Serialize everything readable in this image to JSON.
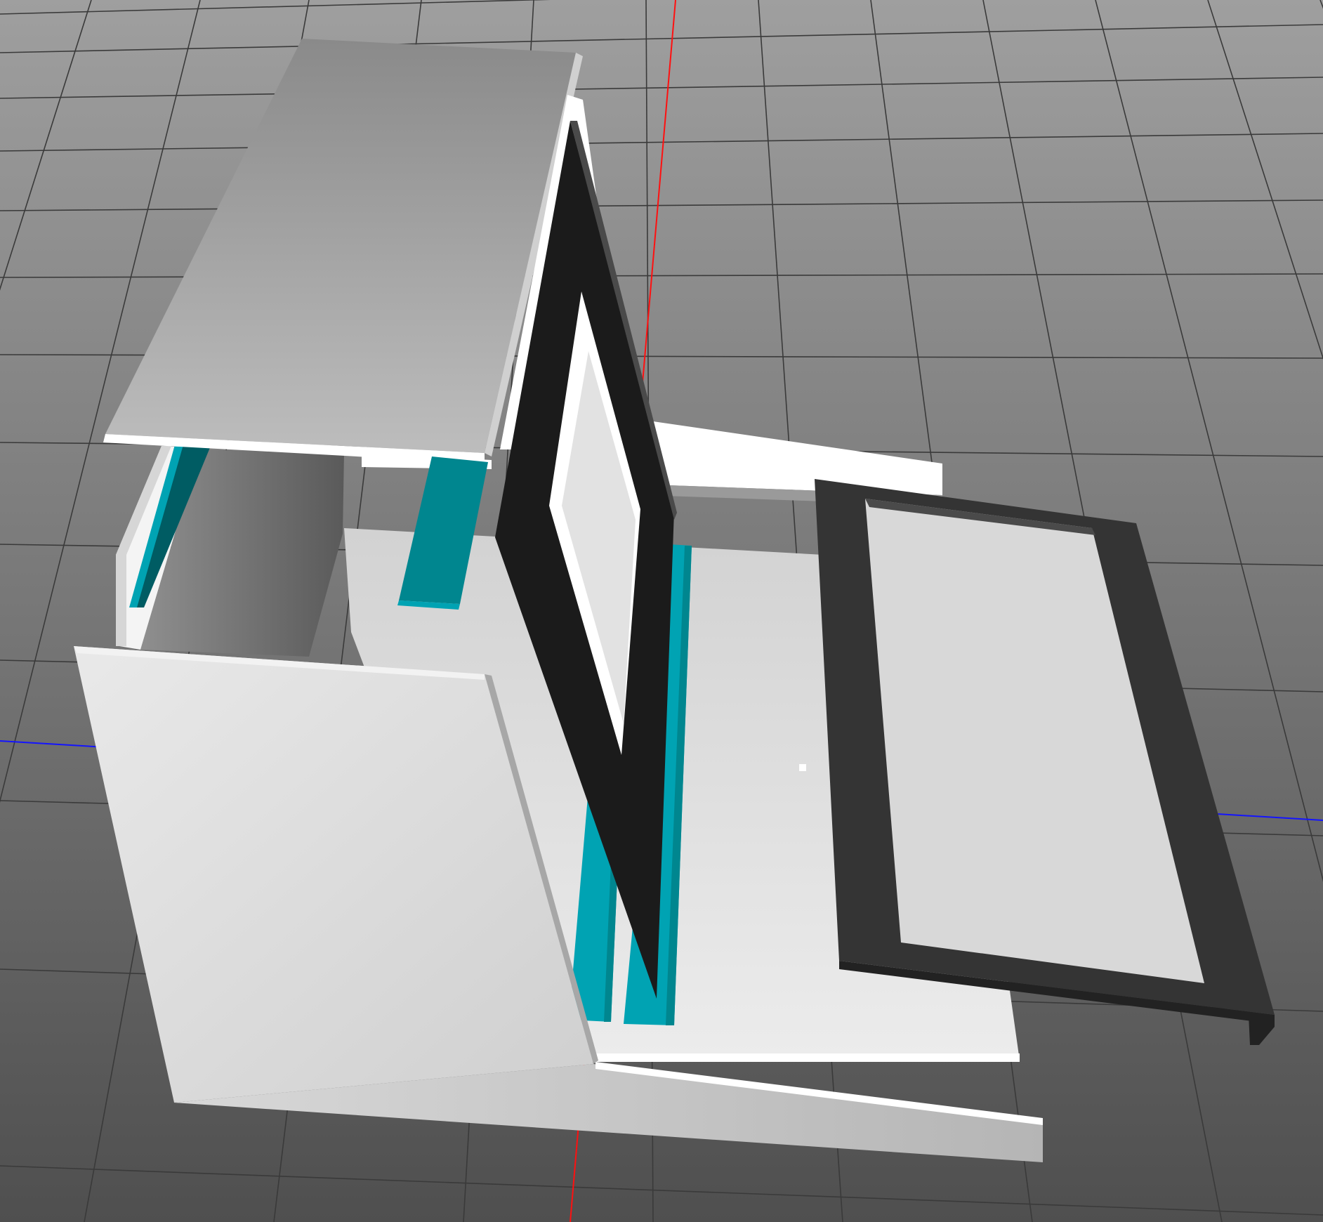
{
  "viewport": {
    "background_top": "#9f9f9f",
    "background_bottom": "#4f4f4f",
    "grid_line_color": "#3a3a3a",
    "x_axis_color": "#1414ff",
    "y_axis_color": "#ff1010",
    "pivot_marker_color": "#ffffff"
  },
  "palette": {
    "panel_light": "#e6e6e6",
    "panel_mid": "#c8c8c8",
    "panel_dark": "#7a7a7a",
    "edge_white": "#ffffff",
    "cavity_dark": "#636363",
    "teal_light": "#00a3b3",
    "teal_mid": "#00868f",
    "teal_dark": "#005c63",
    "frame_black": "#1b1b1b",
    "frame_charcoal": "#343434",
    "frame_edge": "#4a4a4a"
  },
  "objects": [
    {
      "name": "base-plate",
      "kind": "panel"
    },
    {
      "name": "back-wall",
      "kind": "panel"
    },
    {
      "name": "top-cover",
      "kind": "panel"
    },
    {
      "name": "front-panel",
      "kind": "panel"
    },
    {
      "name": "left-side-panel",
      "kind": "panel"
    },
    {
      "name": "inner-cavity",
      "kind": "panel"
    },
    {
      "name": "teal-rail-left",
      "kind": "rail"
    },
    {
      "name": "teal-rail-middle",
      "kind": "rail"
    },
    {
      "name": "teal-rail-right-1",
      "kind": "rail"
    },
    {
      "name": "teal-rail-right-2",
      "kind": "rail"
    },
    {
      "name": "tilted-black-frame",
      "kind": "frame"
    },
    {
      "name": "flat-charcoal-frame",
      "kind": "frame"
    }
  ]
}
